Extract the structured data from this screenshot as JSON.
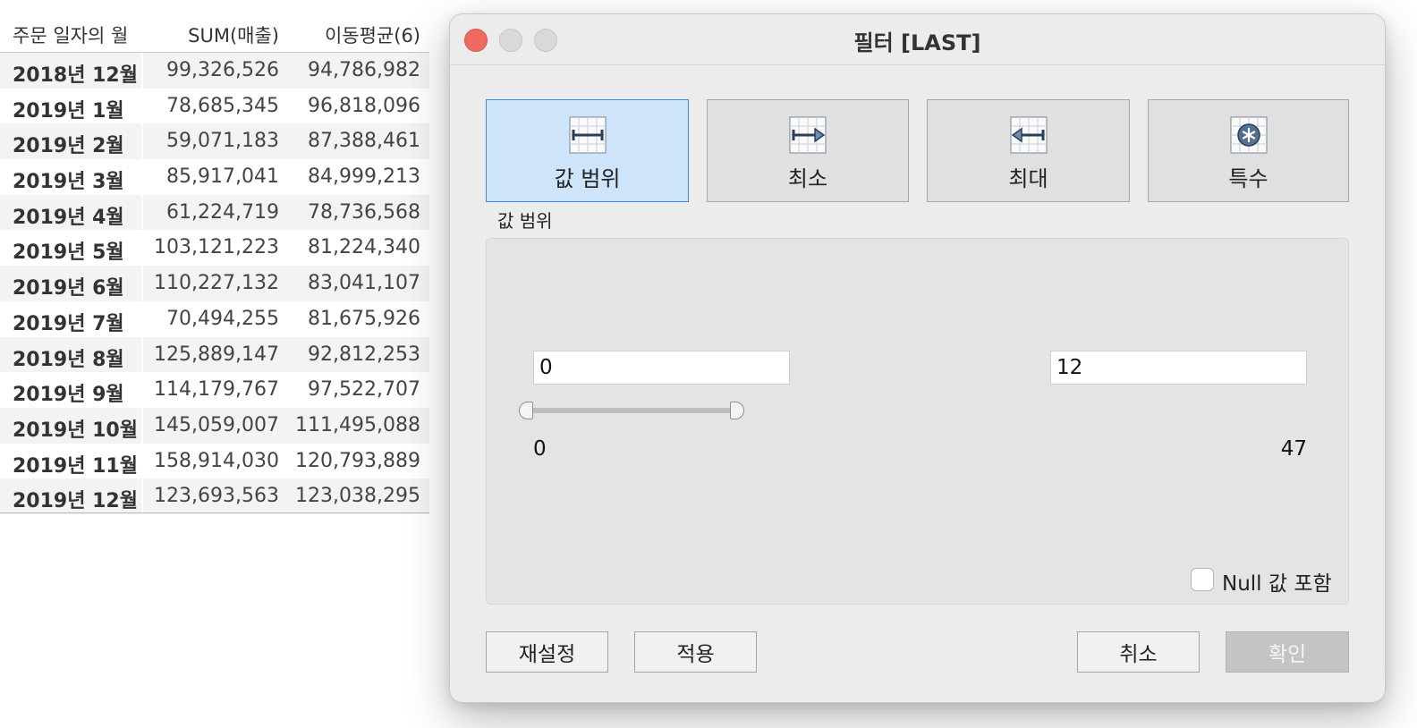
{
  "table": {
    "headers": [
      "주문 일자의 월",
      "SUM(매출)",
      "이동평균(6)"
    ],
    "rows": [
      [
        "2018년 12월",
        "99,326,526",
        "94,786,982"
      ],
      [
        "2019년 1월",
        "78,685,345",
        "96,818,096"
      ],
      [
        "2019년 2월",
        "59,071,183",
        "87,388,461"
      ],
      [
        "2019년 3월",
        "85,917,041",
        "84,999,213"
      ],
      [
        "2019년 4월",
        "61,224,719",
        "78,736,568"
      ],
      [
        "2019년 5월",
        "103,121,223",
        "81,224,340"
      ],
      [
        "2019년 6월",
        "110,227,132",
        "83,041,107"
      ],
      [
        "2019년 7월",
        "70,494,255",
        "81,675,926"
      ],
      [
        "2019년 8월",
        "125,889,147",
        "92,812,253"
      ],
      [
        "2019년 9월",
        "114,179,767",
        "97,522,707"
      ],
      [
        "2019년 10월",
        "145,059,007",
        "111,495,088"
      ],
      [
        "2019년 11월",
        "158,914,030",
        "120,793,889"
      ],
      [
        "2019년 12월",
        "123,693,563",
        "123,038,295"
      ]
    ]
  },
  "dialog": {
    "title": "필터 [LAST]",
    "tabs": [
      {
        "label": "값 범위",
        "icon": "range-icon",
        "active": true
      },
      {
        "label": "최소",
        "icon": "minimum-icon",
        "active": false
      },
      {
        "label": "최대",
        "icon": "maximum-icon",
        "active": false
      },
      {
        "label": "특수",
        "icon": "special-icon",
        "active": false
      }
    ],
    "section_label": "값 범위",
    "range": {
      "min_value": "0",
      "max_value": "12",
      "lower_bound": "0",
      "upper_bound": "47"
    },
    "null_checkbox_label": "Null 값 포함",
    "buttons": {
      "reset": "재설정",
      "apply": "적용",
      "cancel": "취소",
      "ok": "확인"
    },
    "colors": {
      "active_tab": "#cde4fb",
      "active_border": "#3b8be6",
      "close": "#ee6a5f"
    }
  }
}
